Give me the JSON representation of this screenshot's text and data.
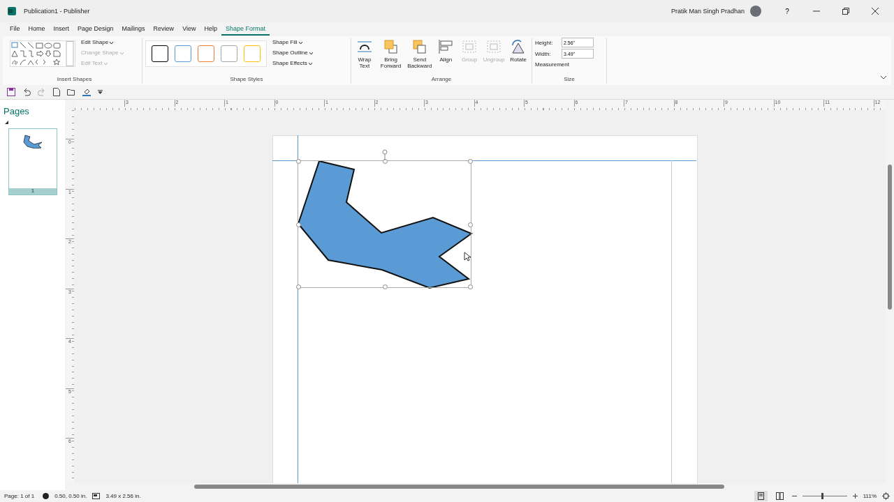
{
  "window": {
    "title": "Publication1  -  Publisher",
    "user": "Pratik Man Singh Pradhan",
    "help": "?"
  },
  "tabs": [
    {
      "label": "File",
      "selected": false
    },
    {
      "label": "Home",
      "selected": false
    },
    {
      "label": "Insert",
      "selected": false
    },
    {
      "label": "Page Design",
      "selected": false
    },
    {
      "label": "Mailings",
      "selected": false
    },
    {
      "label": "Review",
      "selected": false
    },
    {
      "label": "View",
      "selected": false
    },
    {
      "label": "Help",
      "selected": false
    },
    {
      "label": "Shape Format",
      "selected": true
    }
  ],
  "insert_shapes": {
    "label": "Insert Shapes",
    "commands": [
      {
        "label": "Edit Shape",
        "disabled": false
      },
      {
        "label": "Change Shape",
        "disabled": true
      },
      {
        "label": "Edit Text",
        "disabled": true
      }
    ]
  },
  "shape_styles": {
    "label": "Shape Styles",
    "presets": [
      {
        "color": "#000000"
      },
      {
        "color": "#5b9bd5"
      },
      {
        "color": "#ed7d31"
      },
      {
        "color": "#a5a5a5"
      },
      {
        "color": "#ffc000"
      }
    ],
    "commands": [
      {
        "label": "Shape Fill"
      },
      {
        "label": "Shape Outline"
      },
      {
        "label": "Shape Effects"
      }
    ]
  },
  "arrange": {
    "label": "Arrange",
    "buttons": [
      {
        "kind": "wrap",
        "label": "Wrap Text",
        "disabled": false
      },
      {
        "kind": "forward",
        "label": "Bring Forward",
        "disabled": false
      },
      {
        "kind": "backward",
        "label": "Send Backward",
        "disabled": false
      },
      {
        "kind": "align",
        "label": "Align",
        "disabled": false
      },
      {
        "kind": "group",
        "label": "Group",
        "disabled": true
      },
      {
        "kind": "ungroup",
        "label": "Ungroup",
        "disabled": true
      },
      {
        "kind": "rotate",
        "label": "Rotate",
        "disabled": false
      }
    ]
  },
  "size": {
    "label": "Size",
    "height_label": "Height:",
    "height": "2.56\"",
    "width_label": "Width:",
    "width": "3.49\"",
    "measurement": "Measurement"
  },
  "pages_pane": {
    "title": "Pages",
    "pages": [
      {
        "number": "1",
        "selected": true
      }
    ]
  },
  "rulers": {
    "horizontal": [
      "3",
      "2",
      "1",
      "0",
      "1",
      "2",
      "3",
      "4",
      "5",
      "6",
      "7",
      "8",
      "9",
      "10",
      "11",
      "12"
    ],
    "vertical": [
      "0",
      "1",
      "2",
      "3",
      "4",
      "5",
      "6"
    ]
  },
  "status_bar": {
    "page": "Page: 1 of 1",
    "position": "0.50, 0.50 in.",
    "size": "3.49 x  2.56 in.",
    "views": [
      {
        "kind": "single",
        "selected": true
      },
      {
        "kind": "two",
        "selected": false
      }
    ],
    "zoom": {
      "level": 0.42,
      "reading": "111%"
    }
  }
}
